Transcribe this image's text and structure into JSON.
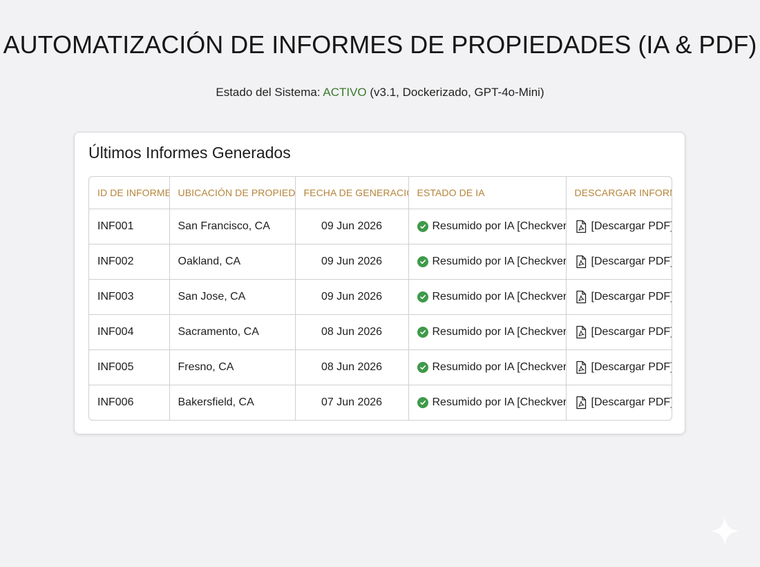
{
  "header": {
    "title": "AUTOMATIZACIÓN DE INFORMES DE PROPIEDADES (IA & PDF)",
    "status_label": "Estado del Sistema: ",
    "status_value": "ACTIVO",
    "status_detail": " (v3.1, Dockerizado, GPT-4o-Mini)",
    "status_color": "#3b7a2c"
  },
  "card": {
    "title": "Últimos Informes Generados"
  },
  "table": {
    "columns": [
      "ID DE INFORME",
      "UBICACIÓN DE PROPIEDAD",
      "FECHA DE GENERACIÓN",
      "ESTADO DE IA",
      "DESCARGAR INFORME"
    ],
    "rows": [
      {
        "id": "INF001",
        "location": "San Francisco, CA",
        "date": "09 Jun 2026",
        "ai_status": "Resumido por IA [Checkverde]",
        "download": "[Descargar PDF]"
      },
      {
        "id": "INF002",
        "location": "Oakland, CA",
        "date": "09 Jun 2026",
        "ai_status": "Resumido por IA [Checkverde]",
        "download": "[Descargar PDF]"
      },
      {
        "id": "INF003",
        "location": "San Jose, CA",
        "date": "09 Jun 2026",
        "ai_status": "Resumido por IA [Checkverde]",
        "download": "[Descargar PDF]"
      },
      {
        "id": "INF004",
        "location": "Sacramento, CA",
        "date": "08 Jun 2026",
        "ai_status": "Resumido por IA [Checkverde]",
        "download": "[Descargar PDF]"
      },
      {
        "id": "INF005",
        "location": "Fresno, CA",
        "date": "08 Jun 2026",
        "ai_status": "Resumido por IA [Checkverde]",
        "download": "[Descargar PDF]"
      },
      {
        "id": "INF006",
        "location": "Bakersfield, CA",
        "date": "07 Jun 2026",
        "ai_status": "Resumido por IA [Checkverde]",
        "download": "[Descargar PDF]"
      }
    ],
    "header_color": "#b5843a",
    "check_color": "#3f9a4a"
  },
  "icons": {
    "status": "check-circle-icon",
    "download": "pdf-file-icon",
    "corner": "sparkle-icon"
  }
}
